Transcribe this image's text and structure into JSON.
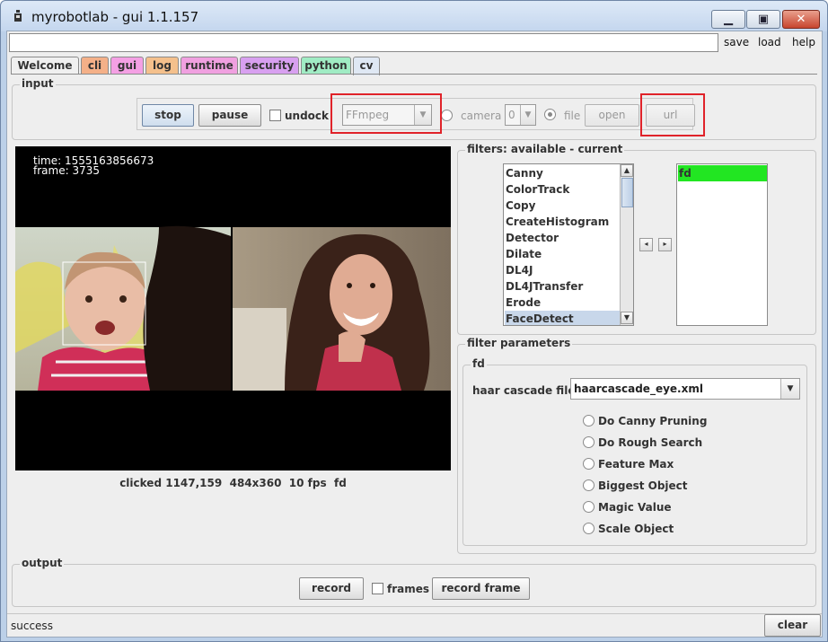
{
  "window": {
    "title": "myrobotlab - gui 1.1.157",
    "minimize": "▁",
    "maximize": "▣",
    "close": "✕"
  },
  "menu": {
    "save": "save",
    "load": "load",
    "help": "help"
  },
  "tabs": [
    {
      "label": "Welcome",
      "color": "#f0f0f0"
    },
    {
      "label": "cli",
      "color": "#f4b088"
    },
    {
      "label": "gui",
      "color": "#f4a0e4"
    },
    {
      "label": "log",
      "color": "#f4c08c"
    },
    {
      "label": "runtime",
      "color": "#f0a0e0"
    },
    {
      "label": "security",
      "color": "#d8a0f0"
    },
    {
      "label": "python",
      "color": "#a0ecc4"
    },
    {
      "label": "cv",
      "color": "#dfe8f4"
    }
  ],
  "input": {
    "group_label": "input",
    "stop": "stop",
    "pause": "pause",
    "undock": "undock",
    "grabber": "FFmpeg",
    "camera": "camera",
    "camera_index": "0",
    "file": "file",
    "open": "open",
    "url": "url"
  },
  "video": {
    "time": "time: 1555163856673",
    "frame": "frame: 3735"
  },
  "video_info": {
    "clicked_label": "clicked",
    "clicked_value": "1147,159",
    "size": "484x360",
    "fps": "10 fps",
    "filter": "fd"
  },
  "filters": {
    "group_label": "filters: available - current",
    "available": [
      "Canny",
      "ColorTrack",
      "Copy",
      "CreateHistogram",
      "Detector",
      "Dilate",
      "DL4J",
      "DL4JTransfer",
      "Erode",
      "FaceDetect"
    ],
    "selected_available": "FaceDetect",
    "current": [
      "fd"
    ],
    "left_arrow": "◂",
    "right_arrow": "▸"
  },
  "filter_params": {
    "group_label": "filter parameters",
    "sub_label": "fd",
    "cascade_label": "haar cascade file",
    "cascade_value": "haarcascade_eye.xml",
    "options": [
      "Do Canny Pruning",
      "Do Rough Search",
      "Feature Max",
      "Biggest Object",
      "Magic Value",
      "Scale Object"
    ]
  },
  "output": {
    "group_label": "output",
    "record": "record",
    "frames": "frames",
    "record_frame": "record frame"
  },
  "status": {
    "text": "success",
    "clear": "clear"
  },
  "colors": {
    "highlight": "#22e622",
    "selection": "#c8d7ea",
    "red_annotation": "#e0232a"
  }
}
